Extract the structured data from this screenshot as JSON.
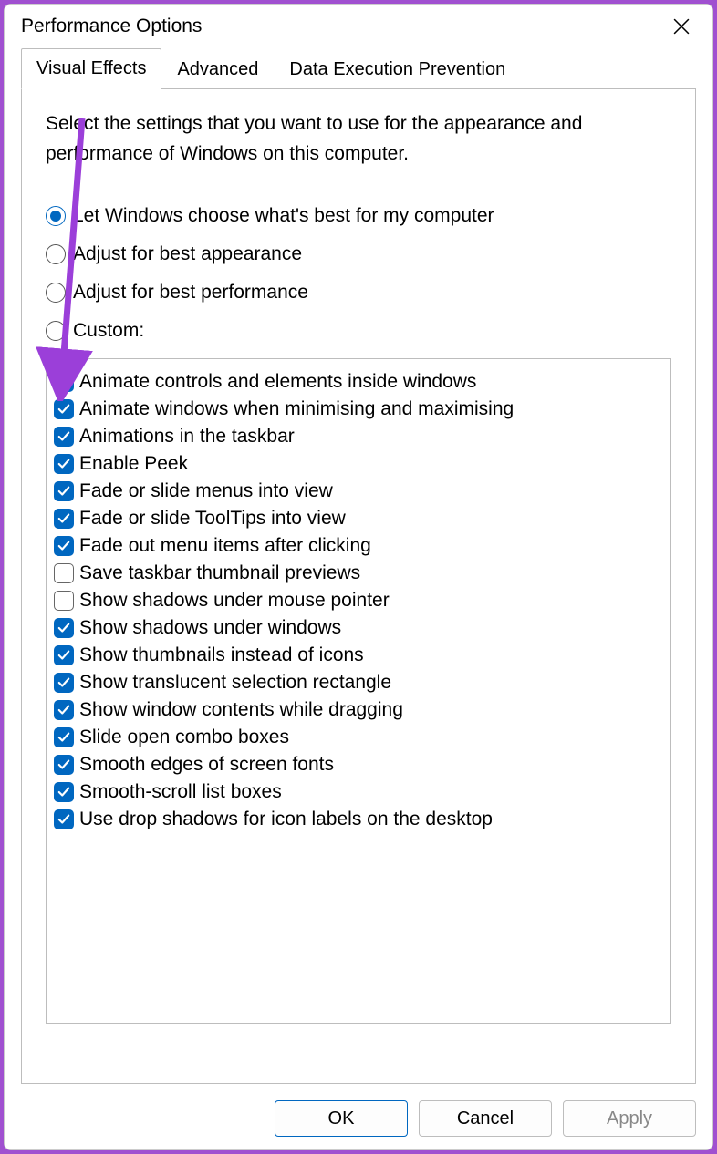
{
  "window_title": "Performance Options",
  "tabs": [
    {
      "label": "Visual Effects",
      "active": true
    },
    {
      "label": "Advanced",
      "active": false
    },
    {
      "label": "Data Execution Prevention",
      "active": false
    }
  ],
  "description": "Select the settings that you want to use for the appearance and performance of Windows on this computer.",
  "radio_options": [
    {
      "label": "Let Windows choose what's best for my computer",
      "checked": true
    },
    {
      "label": "Adjust for best appearance",
      "checked": false
    },
    {
      "label": "Adjust for best performance",
      "checked": false
    },
    {
      "label": "Custom:",
      "checked": false
    }
  ],
  "checkbox_options": [
    {
      "label": "Animate controls and elements inside windows",
      "checked": true
    },
    {
      "label": "Animate windows when minimising and maximising",
      "checked": true
    },
    {
      "label": "Animations in the taskbar",
      "checked": true
    },
    {
      "label": "Enable Peek",
      "checked": true
    },
    {
      "label": "Fade or slide menus into view",
      "checked": true
    },
    {
      "label": "Fade or slide ToolTips into view",
      "checked": true
    },
    {
      "label": "Fade out menu items after clicking",
      "checked": true
    },
    {
      "label": "Save taskbar thumbnail previews",
      "checked": false
    },
    {
      "label": "Show shadows under mouse pointer",
      "checked": false
    },
    {
      "label": "Show shadows under windows",
      "checked": true
    },
    {
      "label": "Show thumbnails instead of icons",
      "checked": true
    },
    {
      "label": "Show translucent selection rectangle",
      "checked": true
    },
    {
      "label": "Show window contents while dragging",
      "checked": true
    },
    {
      "label": "Slide open combo boxes",
      "checked": true
    },
    {
      "label": "Smooth edges of screen fonts",
      "checked": true
    },
    {
      "label": "Smooth-scroll list boxes",
      "checked": true
    },
    {
      "label": "Use drop shadows for icon labels on the desktop",
      "checked": true
    }
  ],
  "buttons": {
    "ok": "OK",
    "cancel": "Cancel",
    "apply": "Apply"
  },
  "colors": {
    "accent": "#0067c0",
    "border": "#bdbdbd",
    "annotation": "#9b3fd9"
  }
}
